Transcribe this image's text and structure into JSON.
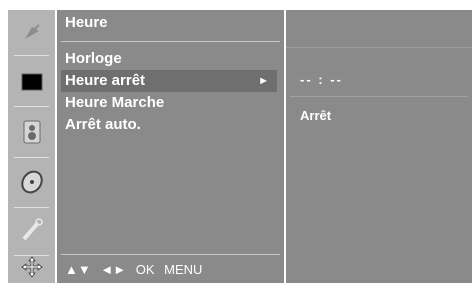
{
  "menu": {
    "title": "Heure",
    "items": [
      {
        "label": "Horloge",
        "active": false
      },
      {
        "label": "Heure arrêt",
        "active": true,
        "arrow": "►"
      },
      {
        "label": "Heure Marche",
        "active": false
      },
      {
        "label": "Arrêt auto.",
        "active": false
      }
    ]
  },
  "hints": {
    "updown": "▲▼",
    "leftright": "◄►",
    "ok": "OK",
    "menu": "MENU"
  },
  "info": {
    "time_value": "-- : --",
    "status_value": "Arrêt"
  },
  "icons": [
    "satellite-dish-icon",
    "screen-icon",
    "speaker-icon",
    "disc-icon",
    "pen-icon",
    "cross-arrows-icon"
  ],
  "colors": {
    "panel": "#8a8a8a",
    "active_row": "#6f6f6f",
    "icon_bar": "#b4b4b4",
    "text": "#ffffff"
  }
}
